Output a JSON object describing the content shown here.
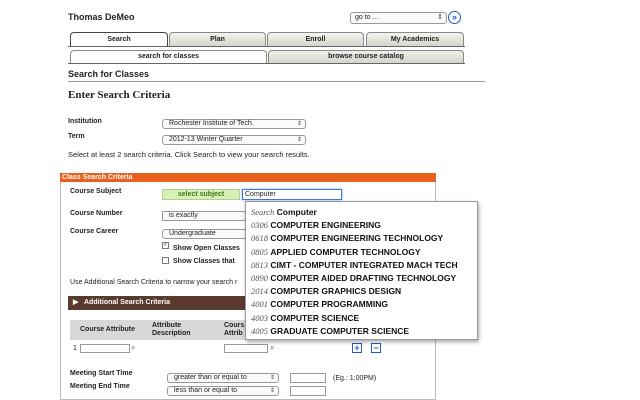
{
  "header": {
    "user_name": "Thomas DeMeo",
    "goto_select": "go to ...",
    "goto_button": "»"
  },
  "tabs": [
    {
      "label": "Search",
      "active": true
    },
    {
      "label": "Plan",
      "active": false
    },
    {
      "label": "Enroll",
      "active": false
    },
    {
      "label": "My Academics",
      "active": false
    }
  ],
  "subtabs": [
    {
      "label": "search for classes",
      "active": true
    },
    {
      "label": "browse course catalog",
      "active": false
    }
  ],
  "page": {
    "section_title": "Search for Classes",
    "heading": "Enter Search Criteria",
    "institution_label": "Institution",
    "institution_value": "Rochester Institute of Tech.",
    "term_label": "Term",
    "term_value": "2012-13 Winter Quarter",
    "instructions": "Select at least 2 search criteria. Click Search to view your search results."
  },
  "criteria": {
    "header": "Class Search Criteria",
    "course_subject_label": "Course Subject",
    "select_subject_button": "select subject",
    "subject_input_value": "Computer",
    "course_number_label": "Course Number",
    "course_number_operator": "is exactly",
    "course_career_label": "Course Career",
    "course_career_value": "Undergraduate",
    "show_open_classes_label": "Show Open Classes",
    "show_open_classes_checked": true,
    "show_classes_that_label": "Show Classes that",
    "additional_note": "Use Additional Search Criteria to narrow your search r",
    "additional_criteria_label": "Additional Search Criteria",
    "attr_headers": {
      "course_attribute": "Course Attribute",
      "attribute_description_1": "Attribute",
      "attribute_description_2": "Description",
      "course_attribute2_1": "Cours",
      "course_attribute2_2": "Attrib"
    },
    "row_number": "1",
    "plus_icon": "+",
    "minus_icon": "−",
    "meeting_start_label": "Meeting Start Time",
    "meeting_start_operator": "greater than or equal to",
    "meeting_end_label": "Meeting End Time",
    "meeting_end_operator": "less than or equal to",
    "time_example": "(Eg.: 1:00PM)"
  },
  "autocomplete": {
    "search_prefix": "Search",
    "search_term": "Computer",
    "items": [
      {
        "code": "0306",
        "name": "COMPUTER ENGINEERING"
      },
      {
        "code": "0618",
        "name": "COMPUTER ENGINEERING TECHNOLOGY"
      },
      {
        "code": "0805",
        "name": "APPLIED COMPUTER TECHNOLOGY"
      },
      {
        "code": "0813",
        "name": "CIMT - COMPUTER INTEGRATED MACH TECH"
      },
      {
        "code": "0890",
        "name": "COMPUTER AIDED DRAFTING TECHNOLOGY"
      },
      {
        "code": "2014",
        "name": "COMPUTER GRAPHICS DESIGN"
      },
      {
        "code": "4001",
        "name": "COMPUTER PROGRAMMING"
      },
      {
        "code": "4003",
        "name": "COMPUTER SCIENCE"
      },
      {
        "code": "4005",
        "name": "GRADUATE COMPUTER SCIENCE"
      }
    ]
  }
}
